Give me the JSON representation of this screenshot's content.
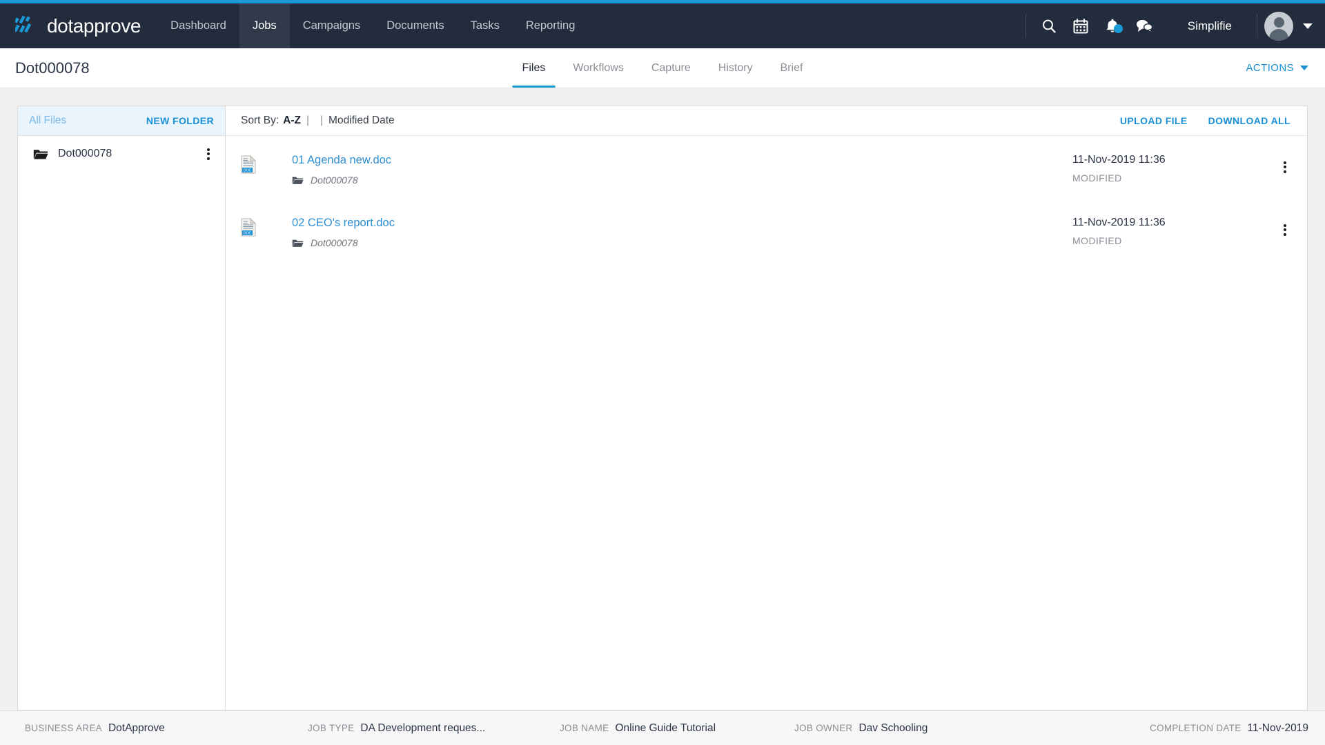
{
  "theme": {
    "accent": "#1b9ad6",
    "nav_bg": "#232c3d",
    "nav_active_bg": "#313a4b",
    "link_blue": "#1b8fd6",
    "file_link": "#2d8fd5",
    "sidebar_head_bg": "#eaf4fc",
    "page_bg": "#f0f0f0"
  },
  "topnav": {
    "brand": "dotapprove",
    "brand_icon": "dotapprove-logo-icon",
    "links": [
      {
        "label": "Dashboard",
        "active": false
      },
      {
        "label": "Jobs",
        "active": true
      },
      {
        "label": "Campaigns",
        "active": false
      },
      {
        "label": "Documents",
        "active": false
      },
      {
        "label": "Tasks",
        "active": false
      },
      {
        "label": "Reporting",
        "active": false
      }
    ],
    "icons": [
      {
        "name": "search-icon",
        "badge": false
      },
      {
        "name": "calendar-icon",
        "badge": false
      },
      {
        "name": "bell-icon",
        "badge": true
      },
      {
        "name": "chat-icon",
        "badge": false
      }
    ],
    "username": "Simplifie",
    "avatar_icon": "user-avatar",
    "user_caret_icon": "chevron-down-icon"
  },
  "subheader": {
    "job_title": "Dot000078",
    "tabs": [
      {
        "label": "Files",
        "active": true
      },
      {
        "label": "Workflows",
        "active": false
      },
      {
        "label": "Capture",
        "active": false
      },
      {
        "label": "History",
        "active": false
      },
      {
        "label": "Brief",
        "active": false
      }
    ],
    "actions_label": "ACTIONS",
    "actions_caret_icon": "chevron-down-icon"
  },
  "sidebar": {
    "header_label": "All Files",
    "new_folder_label": "NEW FOLDER",
    "folders": [
      {
        "name": "Dot000078",
        "icon": "folder-open-icon"
      }
    ],
    "folder_menu_icon": "kebab-menu-icon"
  },
  "filepanel": {
    "sort_label": "Sort By:",
    "sort_active": "A-Z",
    "sort_divider": "|",
    "sort_divider_2": "|",
    "sort_option": "Modified Date",
    "upload_label": "UPLOAD FILE",
    "download_label": "DOWNLOAD ALL",
    "files": [
      {
        "name": "01 Agenda new.doc",
        "type_icon": "doc-file-icon",
        "type_badge": "DOC",
        "folder": "Dot000078",
        "folder_icon": "folder-open-icon",
        "date": "11-Nov-2019 11:36",
        "status": "MODIFIED",
        "menu_icon": "kebab-menu-icon"
      },
      {
        "name": "02 CEO's report.doc",
        "type_icon": "doc-file-icon",
        "type_badge": "DOC",
        "folder": "Dot000078",
        "folder_icon": "folder-open-icon",
        "date": "11-Nov-2019 11:36",
        "status": "MODIFIED",
        "menu_icon": "kebab-menu-icon"
      }
    ]
  },
  "footer": {
    "fields": [
      {
        "label": "BUSINESS AREA",
        "value": "DotApprove"
      },
      {
        "label": "JOB TYPE",
        "value": "DA Development reques..."
      },
      {
        "label": "JOB NAME",
        "value": "Online Guide Tutorial"
      },
      {
        "label": "JOB OWNER",
        "value": "Dav Schooling"
      },
      {
        "label": "COMPLETION DATE",
        "value": "11-Nov-2019"
      }
    ]
  }
}
